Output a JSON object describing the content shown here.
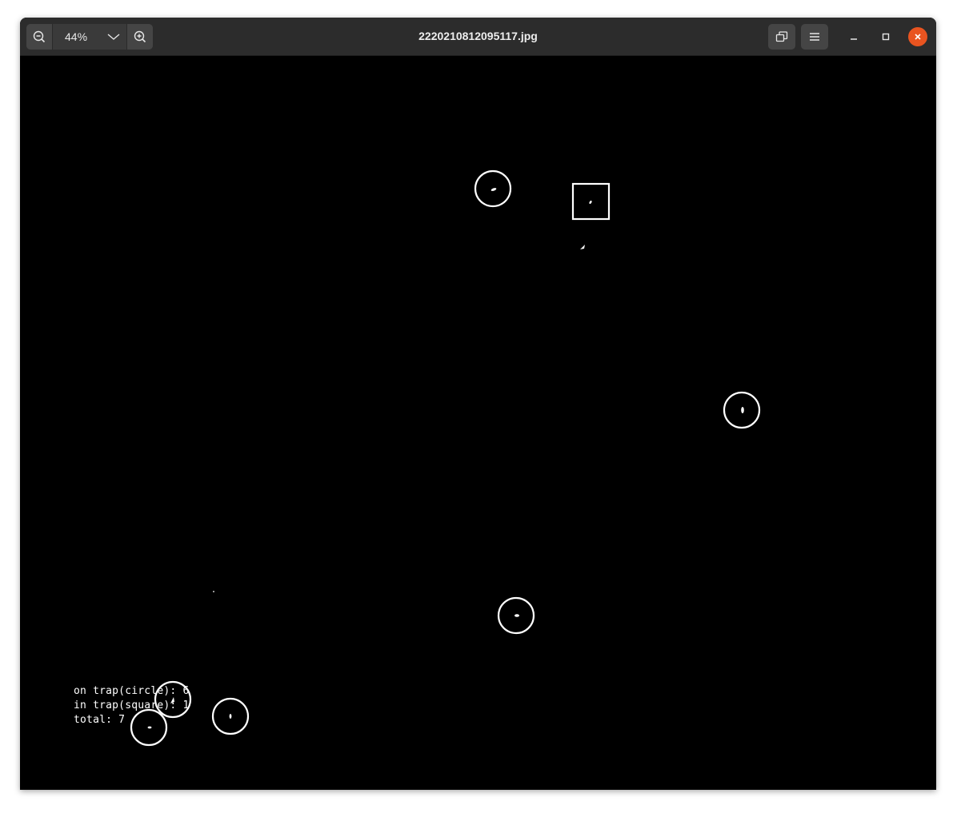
{
  "window": {
    "title": "2220210812095117.jpg"
  },
  "toolbar": {
    "zoom_value": "44%",
    "zoom_out_icon": "zoom-out-icon",
    "zoom_in_icon": "zoom-in-icon",
    "zoom_dropdown_icon": "chevron-down-icon",
    "restore_icon": "window-restore-icon",
    "menu_icon": "hamburger-menu-icon"
  },
  "window_controls": {
    "minimize_icon": "minimize-icon",
    "maximize_icon": "maximize-icon",
    "close_icon": "close-icon",
    "close_color": "#e95420"
  },
  "image": {
    "background": "#000000",
    "overlay_lines": [
      "on trap(circle): 6",
      "in trap(square): 1",
      "total: 7"
    ],
    "circle_marker_count": 6,
    "square_marker_count": 1
  }
}
